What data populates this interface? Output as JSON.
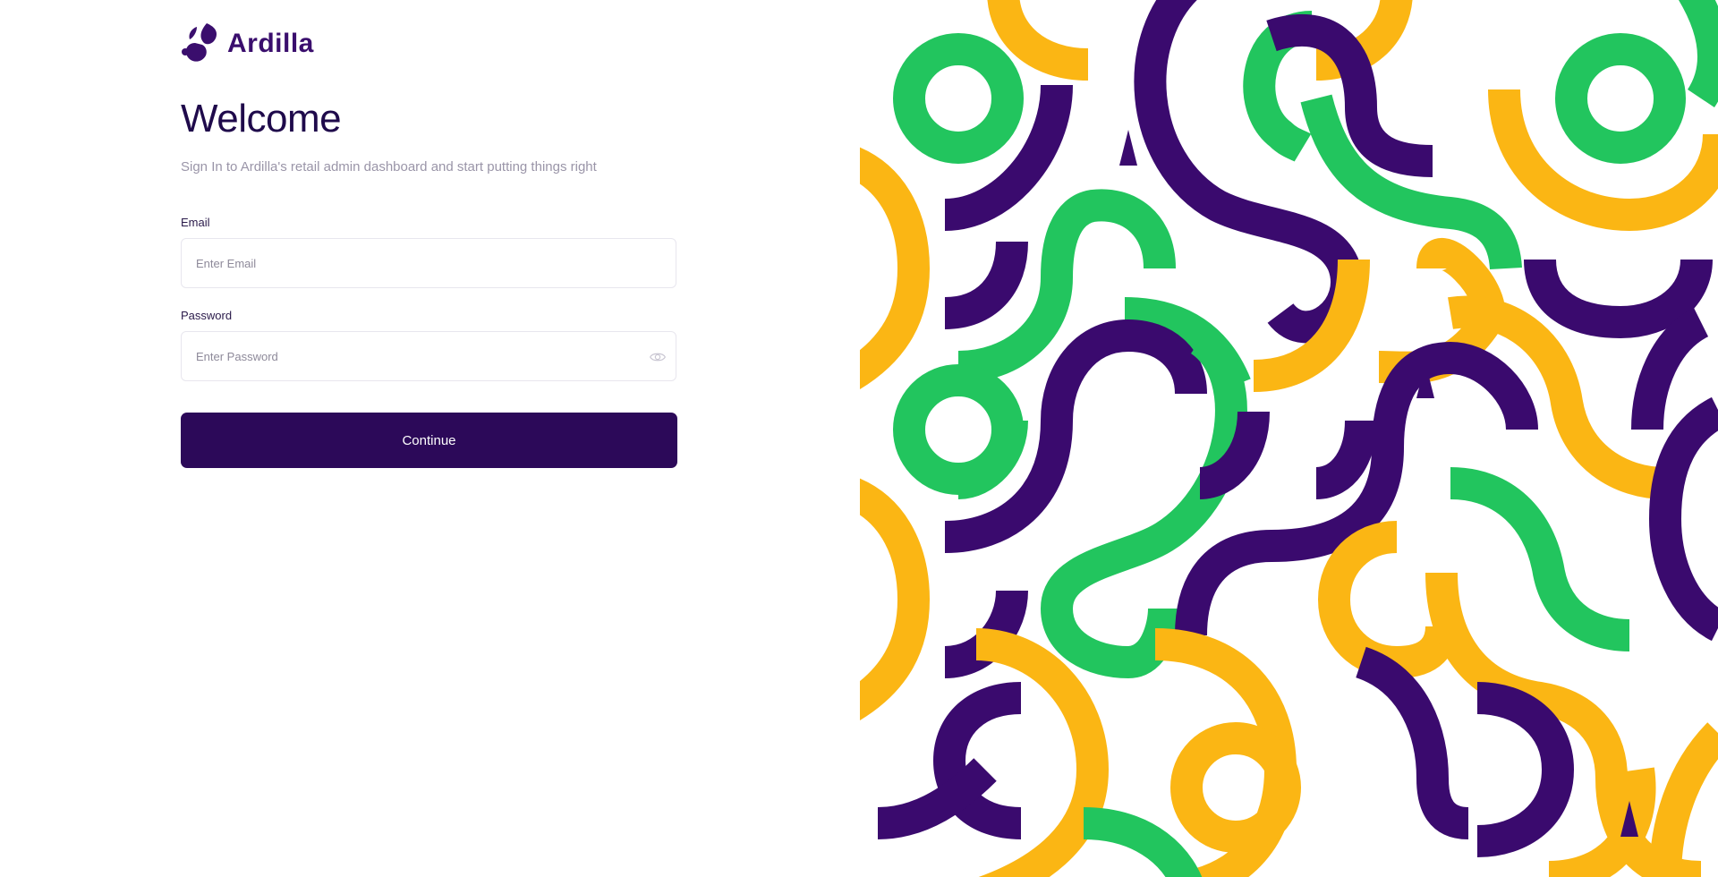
{
  "brand": {
    "name": "Ardilla"
  },
  "welcome": {
    "title": "Welcome",
    "subtitle": "Sign In to Ardilla's retail admin dashboard and start putting things right"
  },
  "form": {
    "email_label": "Email",
    "email_placeholder": "Enter Email",
    "password_label": "Password",
    "password_placeholder": "Enter Password",
    "continue_label": "Continue"
  },
  "icons": {
    "password_toggle": "eye-icon",
    "logo": "leaf-drop-logo-icon"
  },
  "colors": {
    "brand_purple": "#2c0959",
    "title_text": "#1f0a4b",
    "pattern_green": "#22c55e",
    "pattern_yellow": "#fbb614",
    "pattern_purple": "#3a0a6e"
  }
}
